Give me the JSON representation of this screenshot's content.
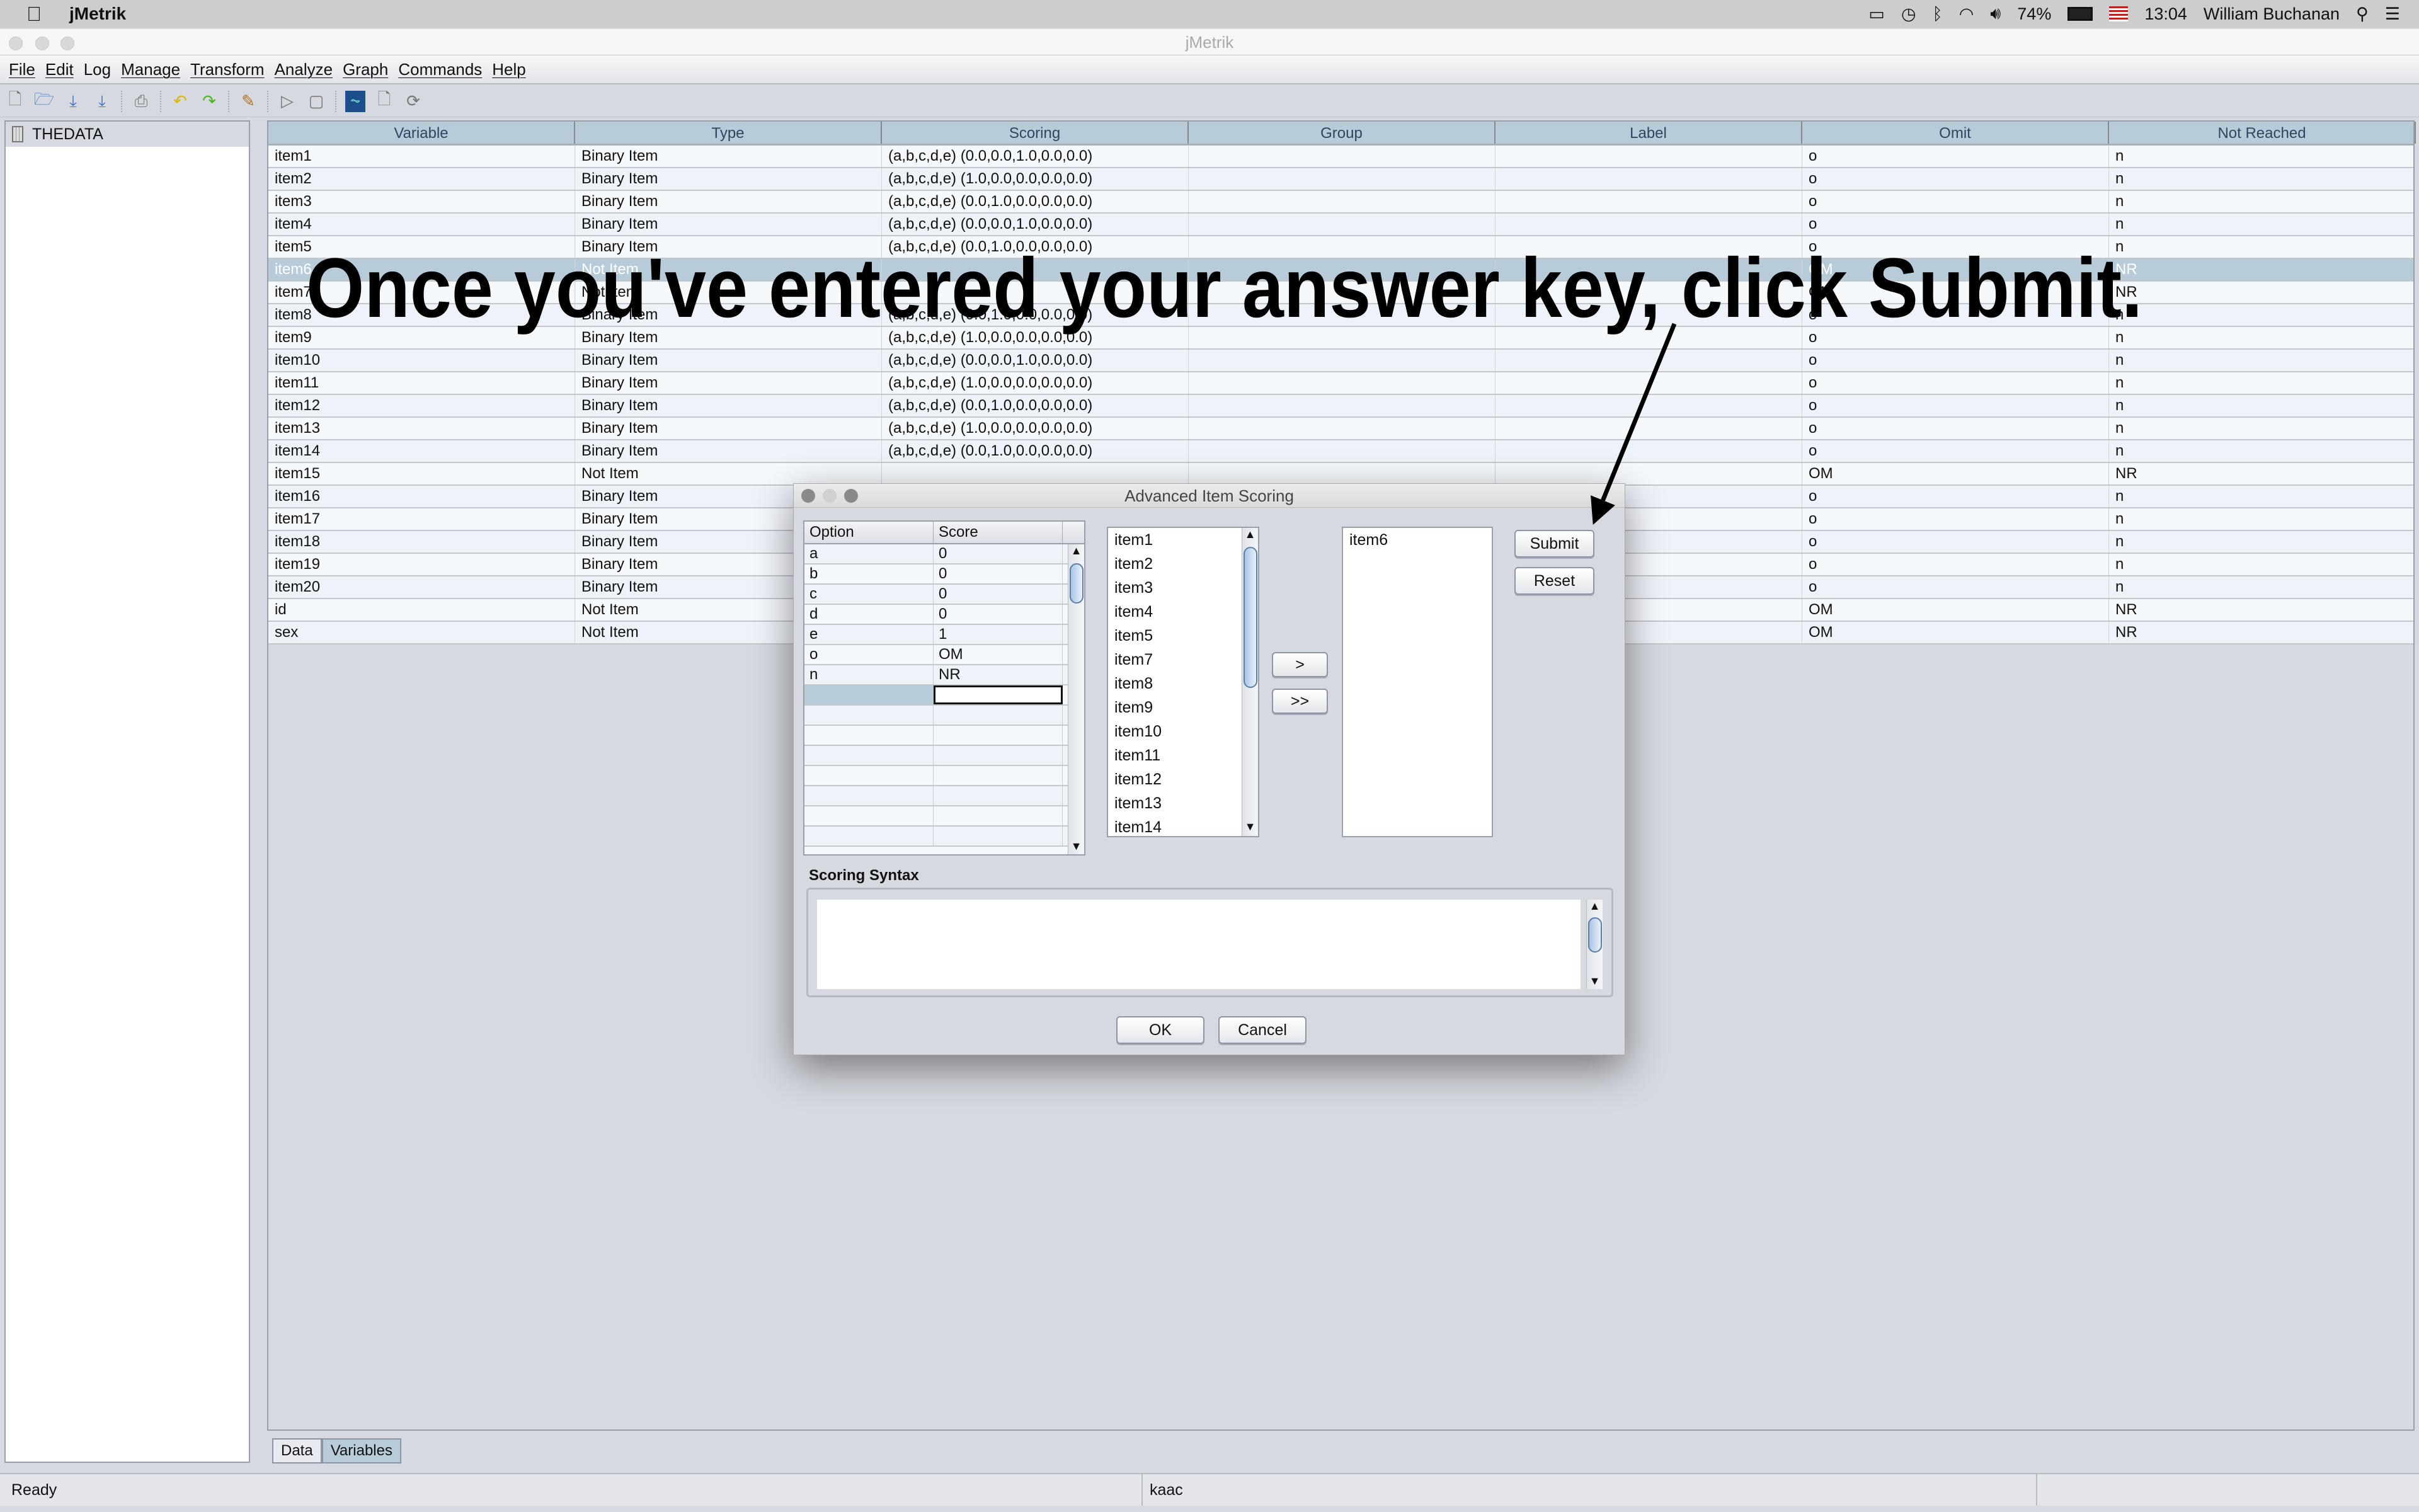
{
  "system_bar": {
    "app_name": "jMetrik",
    "battery": "74%",
    "time": "13:04",
    "user": "William Buchanan"
  },
  "window": {
    "title": "jMetrik"
  },
  "menu": [
    "File",
    "Edit",
    "Log",
    "Manage",
    "Transform",
    "Analyze",
    "Graph",
    "Commands",
    "Help"
  ],
  "sidebar": {
    "dataset": "THEDATA"
  },
  "table": {
    "columns": [
      "Variable",
      "Type",
      "Scoring",
      "Group",
      "Label",
      "Omit",
      "Not Reached"
    ],
    "rows": [
      [
        "item1",
        "Binary Item",
        "(a,b,c,d,e) (0.0,0.0,1.0,0.0,0.0)",
        "",
        "",
        "o",
        "n"
      ],
      [
        "item2",
        "Binary Item",
        "(a,b,c,d,e) (1.0,0.0,0.0,0.0,0.0)",
        "",
        "",
        "o",
        "n"
      ],
      [
        "item3",
        "Binary Item",
        "(a,b,c,d,e) (0.0,1.0,0.0,0.0,0.0)",
        "",
        "",
        "o",
        "n"
      ],
      [
        "item4",
        "Binary Item",
        "(a,b,c,d,e) (0.0,0.0,1.0,0.0,0.0)",
        "",
        "",
        "o",
        "n"
      ],
      [
        "item5",
        "Binary Item",
        "(a,b,c,d,e) (0.0,1.0,0.0,0.0,0.0)",
        "",
        "",
        "o",
        "n"
      ],
      [
        "item6",
        "Not Item",
        "",
        "",
        "",
        "OM",
        "NR"
      ],
      [
        "item7",
        "Not Item",
        "",
        "",
        "",
        "OM",
        "NR"
      ],
      [
        "item8",
        "Binary Item",
        "(a,b,c,d,e) (0.0,1.0,0.0,0.0,0.0)",
        "",
        "",
        "o",
        "n"
      ],
      [
        "item9",
        "Binary Item",
        "(a,b,c,d,e) (1.0,0.0,0.0,0.0,0.0)",
        "",
        "",
        "o",
        "n"
      ],
      [
        "item10",
        "Binary Item",
        "(a,b,c,d,e) (0.0,0.0,1.0,0.0,0.0)",
        "",
        "",
        "o",
        "n"
      ],
      [
        "item11",
        "Binary Item",
        "(a,b,c,d,e) (1.0,0.0,0.0,0.0,0.0)",
        "",
        "",
        "o",
        "n"
      ],
      [
        "item12",
        "Binary Item",
        "(a,b,c,d,e) (0.0,1.0,0.0,0.0,0.0)",
        "",
        "",
        "o",
        "n"
      ],
      [
        "item13",
        "Binary Item",
        "(a,b,c,d,e) (1.0,0.0,0.0,0.0,0.0)",
        "",
        "",
        "o",
        "n"
      ],
      [
        "item14",
        "Binary Item",
        "(a,b,c,d,e) (0.0,1.0,0.0,0.0,0.0)",
        "",
        "",
        "o",
        "n"
      ],
      [
        "item15",
        "Not Item",
        "",
        "",
        "",
        "OM",
        "NR"
      ],
      [
        "item16",
        "Binary Item",
        "",
        "",
        "",
        "o",
        "n"
      ],
      [
        "item17",
        "Binary Item",
        "",
        "",
        "",
        "o",
        "n"
      ],
      [
        "item18",
        "Binary Item",
        "",
        "",
        "",
        "o",
        "n"
      ],
      [
        "item19",
        "Binary Item",
        "",
        "",
        "",
        "o",
        "n"
      ],
      [
        "item20",
        "Binary Item",
        "",
        "",
        "",
        "o",
        "n"
      ],
      [
        "id",
        "Not Item",
        "",
        "",
        "",
        "OM",
        "NR"
      ],
      [
        "sex",
        "Not Item",
        "",
        "",
        "",
        "OM",
        "NR"
      ]
    ],
    "selected_row": 5
  },
  "bottom_tabs": [
    "Data",
    "Variables"
  ],
  "status": {
    "left": "Ready",
    "middle": "kaac"
  },
  "dialog": {
    "title": "Advanced Item Scoring",
    "option_header": [
      "Option",
      "Score"
    ],
    "options": [
      [
        "a",
        "0"
      ],
      [
        "b",
        "0"
      ],
      [
        "c",
        "0"
      ],
      [
        "d",
        "0"
      ],
      [
        "e",
        "1"
      ],
      [
        "o",
        "OM"
      ],
      [
        "n",
        "NR"
      ]
    ],
    "available_items": [
      "item1",
      "item2",
      "item3",
      "item4",
      "item5",
      "item7",
      "item8",
      "item9",
      "item10",
      "item11",
      "item12",
      "item13",
      "item14"
    ],
    "selected_items": [
      "item6"
    ],
    "move_one": ">",
    "move_all": ">>",
    "submit": "Submit",
    "reset": "Reset",
    "syntax_label": "Scoring Syntax",
    "syntax_value": "",
    "ok": "OK",
    "cancel": "Cancel"
  },
  "annotation": {
    "text": "Once you've entered your answer key, click Submit."
  }
}
